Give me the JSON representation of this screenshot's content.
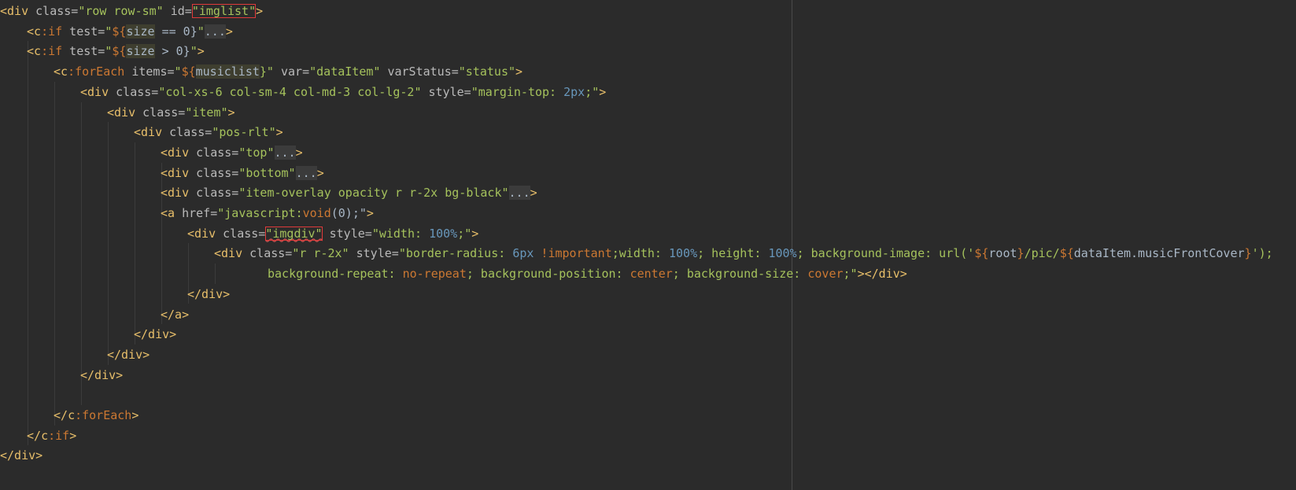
{
  "colors": {
    "background": "#2b2b2b",
    "tag": "#e8bf6a",
    "attr": "#bababa",
    "string": "#a5c25c",
    "number": "#6897bb",
    "keyword": "#cc7832",
    "plain": "#a9b7c6",
    "fold_bg": "#3b3b3b",
    "el_bg": "#3e3e2f",
    "highlight_box": "#e03a3a"
  },
  "code": {
    "lines": [
      {
        "indent": 0,
        "tokens": [
          {
            "t": "<div",
            "c": "tag"
          },
          {
            "t": " class=",
            "c": "attr"
          },
          {
            "t": "\"row row-sm\"",
            "c": "string"
          },
          {
            "t": " id=",
            "c": "attr"
          },
          {
            "t": "\"imglist\"",
            "c": "string",
            "box": true
          },
          {
            "t": ">",
            "c": "tag"
          }
        ]
      },
      {
        "indent": 1,
        "tokens": [
          {
            "t": "<",
            "c": "tag"
          },
          {
            "t": "c",
            "c": "tag"
          },
          {
            "t": ":if",
            "c": "keyword"
          },
          {
            "t": " test=",
            "c": "attr"
          },
          {
            "t": "\"",
            "c": "string"
          },
          {
            "t": "${",
            "c": "keyword"
          },
          {
            "t": "size",
            "c": "plain",
            "bg": "el_bg"
          },
          {
            "t": " == 0}",
            "c": "plain"
          },
          {
            "t": "\"",
            "c": "string"
          },
          {
            "t": "...",
            "c": "plain",
            "bg": "fold_bg"
          },
          {
            "t": ">",
            "c": "tag"
          }
        ]
      },
      {
        "indent": 1,
        "tokens": [
          {
            "t": "<",
            "c": "tag"
          },
          {
            "t": "c",
            "c": "tag"
          },
          {
            "t": ":if",
            "c": "keyword"
          },
          {
            "t": " test=",
            "c": "attr"
          },
          {
            "t": "\"",
            "c": "string"
          },
          {
            "t": "${",
            "c": "keyword"
          },
          {
            "t": "size",
            "c": "plain",
            "bg": "el_bg"
          },
          {
            "t": " > 0}",
            "c": "plain"
          },
          {
            "t": "\"",
            "c": "string"
          },
          {
            "t": ">",
            "c": "tag"
          }
        ]
      },
      {
        "indent": 2,
        "tokens": [
          {
            "t": "<",
            "c": "tag"
          },
          {
            "t": "c",
            "c": "tag"
          },
          {
            "t": ":forEach",
            "c": "keyword"
          },
          {
            "t": " items=",
            "c": "attr"
          },
          {
            "t": "\"",
            "c": "string"
          },
          {
            "t": "${",
            "c": "keyword"
          },
          {
            "t": "musiclist",
            "c": "plain",
            "bg": "el_bg"
          },
          {
            "t": "}\"",
            "c": "string"
          },
          {
            "t": " var=",
            "c": "attr"
          },
          {
            "t": "\"dataItem\"",
            "c": "string"
          },
          {
            "t": " varStatus=",
            "c": "attr"
          },
          {
            "t": "\"status\"",
            "c": "string"
          },
          {
            "t": ">",
            "c": "tag"
          }
        ]
      },
      {
        "indent": 3,
        "tokens": [
          {
            "t": "<div",
            "c": "tag"
          },
          {
            "t": " class=",
            "c": "attr"
          },
          {
            "t": "\"col-xs-6 col-sm-4 col-md-3 col-lg-2\"",
            "c": "string"
          },
          {
            "t": " style=",
            "c": "attr"
          },
          {
            "t": "\"margin-top: ",
            "c": "string"
          },
          {
            "t": "2px",
            "c": "number"
          },
          {
            "t": ";\"",
            "c": "string"
          },
          {
            "t": ">",
            "c": "tag"
          }
        ]
      },
      {
        "indent": 4,
        "tokens": [
          {
            "t": "<div",
            "c": "tag"
          },
          {
            "t": " class=",
            "c": "attr"
          },
          {
            "t": "\"item\"",
            "c": "string"
          },
          {
            "t": ">",
            "c": "tag"
          }
        ]
      },
      {
        "indent": 5,
        "tokens": [
          {
            "t": "<div",
            "c": "tag"
          },
          {
            "t": " class=",
            "c": "attr"
          },
          {
            "t": "\"pos-rlt\"",
            "c": "string"
          },
          {
            "t": ">",
            "c": "tag"
          }
        ]
      },
      {
        "indent": 6,
        "tokens": [
          {
            "t": "<div",
            "c": "tag"
          },
          {
            "t": " class=",
            "c": "attr"
          },
          {
            "t": "\"top\"",
            "c": "string"
          },
          {
            "t": "...",
            "c": "plain",
            "bg": "fold_bg"
          },
          {
            "t": ">",
            "c": "tag"
          }
        ]
      },
      {
        "indent": 6,
        "tokens": [
          {
            "t": "<div",
            "c": "tag"
          },
          {
            "t": " class=",
            "c": "attr"
          },
          {
            "t": "\"bottom\"",
            "c": "string"
          },
          {
            "t": "...",
            "c": "plain",
            "bg": "fold_bg"
          },
          {
            "t": ">",
            "c": "tag"
          }
        ]
      },
      {
        "indent": 6,
        "tokens": [
          {
            "t": "<div",
            "c": "tag"
          },
          {
            "t": " class=",
            "c": "attr"
          },
          {
            "t": "\"item-overlay opacity r r-2x bg-black\"",
            "c": "string"
          },
          {
            "t": "...",
            "c": "plain",
            "bg": "fold_bg"
          },
          {
            "t": ">",
            "c": "tag"
          }
        ]
      },
      {
        "indent": 6,
        "tokens": [
          {
            "t": "<a",
            "c": "tag"
          },
          {
            "t": " href=",
            "c": "attr"
          },
          {
            "t": "\"javascript:",
            "c": "string"
          },
          {
            "t": "void",
            "c": "keyword"
          },
          {
            "t": "(0);\"",
            "c": "plain"
          },
          {
            "t": ">",
            "c": "tag"
          }
        ]
      },
      {
        "indent": 7,
        "tokens": [
          {
            "t": "<div",
            "c": "tag"
          },
          {
            "t": " class=",
            "c": "attr"
          },
          {
            "t": "\"imgdiv\"",
            "c": "string",
            "box": true,
            "squiggle": true
          },
          {
            "t": " style=",
            "c": "attr"
          },
          {
            "t": "\"width: ",
            "c": "string"
          },
          {
            "t": "100%",
            "c": "number"
          },
          {
            "t": ";\"",
            "c": "string"
          },
          {
            "t": ">",
            "c": "tag"
          }
        ]
      },
      {
        "indent": 8,
        "tokens": [
          {
            "t": "<div",
            "c": "tag"
          },
          {
            "t": " class=",
            "c": "attr"
          },
          {
            "t": "\"r r-2x\"",
            "c": "string"
          },
          {
            "t": " style=",
            "c": "attr"
          },
          {
            "t": "\"border-radius: ",
            "c": "string"
          },
          {
            "t": "6px",
            "c": "number"
          },
          {
            "t": " !important",
            "c": "keyword"
          },
          {
            "t": ";width: ",
            "c": "string"
          },
          {
            "t": "100%",
            "c": "number"
          },
          {
            "t": "; height: ",
            "c": "string"
          },
          {
            "t": "100%",
            "c": "number"
          },
          {
            "t": "; background-image: url('",
            "c": "string"
          },
          {
            "t": "${",
            "c": "keyword"
          },
          {
            "t": "root",
            "c": "plain"
          },
          {
            "t": "}",
            "c": "keyword"
          },
          {
            "t": "/pic/",
            "c": "string"
          },
          {
            "t": "${",
            "c": "keyword"
          },
          {
            "t": "dataItem.musicFrontCover",
            "c": "plain"
          },
          {
            "t": "}",
            "c": "keyword"
          },
          {
            "t": "');",
            "c": "string"
          }
        ]
      },
      {
        "indent": 10,
        "tokens": [
          {
            "t": "background-repeat: ",
            "c": "string"
          },
          {
            "t": "no-repeat",
            "c": "keyword"
          },
          {
            "t": "; background-position: ",
            "c": "string"
          },
          {
            "t": "center",
            "c": "keyword"
          },
          {
            "t": "; background-size: ",
            "c": "string"
          },
          {
            "t": "cover",
            "c": "keyword"
          },
          {
            "t": ";\"",
            "c": "string"
          },
          {
            "t": "></div>",
            "c": "tag"
          }
        ]
      },
      {
        "indent": 7,
        "tokens": [
          {
            "t": "</div>",
            "c": "tag"
          }
        ]
      },
      {
        "indent": 6,
        "tokens": [
          {
            "t": "</a>",
            "c": "tag"
          }
        ]
      },
      {
        "indent": 5,
        "tokens": [
          {
            "t": "</div>",
            "c": "tag"
          }
        ]
      },
      {
        "indent": 4,
        "tokens": [
          {
            "t": "</div>",
            "c": "tag"
          }
        ]
      },
      {
        "indent": 3,
        "tokens": [
          {
            "t": "</div>",
            "c": "tag"
          }
        ]
      },
      {
        "indent": 0,
        "tokens": []
      },
      {
        "indent": 2,
        "tokens": [
          {
            "t": "</",
            "c": "tag"
          },
          {
            "t": "c",
            "c": "tag"
          },
          {
            "t": ":forEach",
            "c": "keyword"
          },
          {
            "t": ">",
            "c": "tag"
          }
        ]
      },
      {
        "indent": 1,
        "tokens": [
          {
            "t": "</",
            "c": "tag"
          },
          {
            "t": "c",
            "c": "tag"
          },
          {
            "t": ":if",
            "c": "keyword"
          },
          {
            "t": ">",
            "c": "tag"
          }
        ]
      },
      {
        "indent": 0,
        "tokens": [
          {
            "t": "</div>",
            "c": "tag"
          }
        ]
      }
    ]
  }
}
